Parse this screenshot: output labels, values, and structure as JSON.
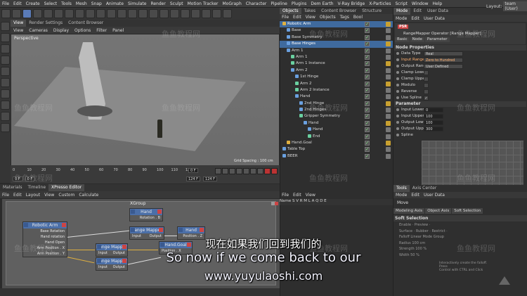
{
  "menubar": {
    "items": [
      "File",
      "Edit",
      "Create",
      "Select",
      "Tools",
      "Mesh",
      "Snap",
      "Animate",
      "Simulate",
      "Render",
      "Sculpt",
      "Motion Tracker",
      "MoGraph",
      "Character",
      "Pipeline",
      "Plugins",
      "Dem Earth",
      "V-Ray Bridge",
      "X-Particles",
      "Script",
      "Window",
      "Help"
    ],
    "layout_label": "Layout:",
    "layout_value": "team (User)"
  },
  "viewport": {
    "tabs": [
      "View",
      "Render Settings",
      "Content Browser"
    ],
    "menu": [
      "View",
      "Cameras",
      "Display",
      "Options",
      "Filter",
      "Panel"
    ],
    "label": "Perspective",
    "grid_spacing": "Grid Spacing : 100 cm"
  },
  "timeline": {
    "ticks": [
      "0",
      "10",
      "20",
      "30",
      "40",
      "50",
      "60",
      "70",
      "80",
      "90",
      "100",
      "110",
      "120"
    ],
    "current_frame": "0 F",
    "start_frame": "0 F",
    "end_frame": "124 F",
    "end_frame2": "124 F"
  },
  "objects": {
    "tabs": [
      "Objects",
      "Takes",
      "Content Browser",
      "Structure"
    ],
    "menu": [
      "File",
      "Edit",
      "View",
      "Objects",
      "Tags",
      "Bool"
    ],
    "items": [
      {
        "name": "Robotic Arm",
        "indent": 0,
        "sel": true,
        "color": "#e0b040"
      },
      {
        "name": "Base",
        "indent": 1,
        "sel": false,
        "color": "#6aa0e0"
      },
      {
        "name": "Base Symmetry",
        "indent": 1,
        "sel": false,
        "color": "#6aa0e0"
      },
      {
        "name": "Base Hinges",
        "indent": 1,
        "sel": true,
        "color": "#6aa0e0"
      },
      {
        "name": "Arm 1",
        "indent": 1,
        "sel": false,
        "color": "#6aa0e0"
      },
      {
        "name": "Arm 1",
        "indent": 2,
        "sel": false,
        "color": "#6ad0a0"
      },
      {
        "name": "Arm 1 Instance",
        "indent": 2,
        "sel": false,
        "color": "#6ad0a0"
      },
      {
        "name": "Arm 2",
        "indent": 2,
        "sel": false,
        "color": "#6aa0e0"
      },
      {
        "name": "1st Hinge",
        "indent": 3,
        "sel": false,
        "color": "#6aa0e0"
      },
      {
        "name": "Arm 2",
        "indent": 3,
        "sel": false,
        "color": "#6ad0a0"
      },
      {
        "name": "Arm 2 Instance",
        "indent": 3,
        "sel": false,
        "color": "#6ad0a0"
      },
      {
        "name": "Hand",
        "indent": 3,
        "sel": false,
        "color": "#6aa0e0"
      },
      {
        "name": "2nd Hinge",
        "indent": 4,
        "sel": false,
        "color": "#6aa0e0"
      },
      {
        "name": "2nd Hinges",
        "indent": 4,
        "sel": false,
        "color": "#6aa0e0"
      },
      {
        "name": "Gripper Symmetry",
        "indent": 4,
        "sel": false,
        "color": "#6ad0a0"
      },
      {
        "name": "Hand",
        "indent": 5,
        "sel": false,
        "color": "#6aa0e0"
      },
      {
        "name": "Hand",
        "indent": 6,
        "sel": false,
        "color": "#6aa0e0"
      },
      {
        "name": "End",
        "indent": 6,
        "sel": false,
        "color": "#6ad0a0"
      },
      {
        "name": "Hand.Goal",
        "indent": 1,
        "sel": false,
        "color": "#e0b040"
      },
      {
        "name": "Table Top",
        "indent": 0,
        "sel": false,
        "color": "#6aa0e0"
      },
      {
        "name": "BEER",
        "indent": 0,
        "sel": false,
        "color": "#6aa0e0"
      }
    ]
  },
  "attributes": {
    "tabs": [
      "Mode",
      "Edit",
      "User Data"
    ],
    "menu": [
      "Mode",
      "Edit",
      "User Data"
    ],
    "badge": "PSR",
    "title": "RangeMapper Operator [Range Mapper]",
    "subtabs": [
      "Basic",
      "Node",
      "Parameter"
    ],
    "section_node": "Node Properties",
    "node_props": [
      {
        "label": "Data Type",
        "value": "Real",
        "type": "drop",
        "hl": false
      },
      {
        "label": "Input Range",
        "value": "Zero to Hundred",
        "type": "drop",
        "hl": true
      },
      {
        "label": "Output Range",
        "value": "User Defined",
        "type": "drop",
        "hl": false
      },
      {
        "label": "Clamp Lower",
        "value": "",
        "type": "chk",
        "hl": false
      },
      {
        "label": "Clamp Upper",
        "value": "",
        "type": "chk",
        "hl": false
      },
      {
        "label": "Modulo",
        "value": "",
        "type": "chk",
        "hl": false
      },
      {
        "label": "Reverse",
        "value": "",
        "type": "chk",
        "hl": false
      },
      {
        "label": "Use Spline",
        "value": "✓",
        "type": "chk",
        "hl": false
      }
    ],
    "section_param": "Parameter",
    "param_props": [
      {
        "label": "Input Lower",
        "value": "0"
      },
      {
        "label": "Input Upper",
        "value": "100"
      },
      {
        "label": "Output Lower",
        "value": "100"
      },
      {
        "label": "Output Upper",
        "value": "300"
      }
    ],
    "spline_label": "Spline"
  },
  "xpresso": {
    "tabs": [
      "Materials",
      "Timeline",
      "XPresso Editor"
    ],
    "menu": [
      "File",
      "Edit",
      "Layout",
      "View",
      "Custom",
      "Calculate"
    ],
    "group_title": "XGroup",
    "nodes": {
      "robotic_arm": {
        "title": "Robotic Arm",
        "ports": [
          "Base Rotation",
          "Hand rotation",
          "Hand Open",
          "Arm Position . X",
          "Arm Position . Y"
        ]
      },
      "hand_top": {
        "title": "Hand",
        "ports": [
          "Rotation . B"
        ]
      },
      "range_mapper_1": {
        "title": "Range Mapper",
        "in": "Input",
        "out": "Output"
      },
      "range_mapper_2": {
        "title": "Range Mapper",
        "in": "Input",
        "out": "Output"
      },
      "range_mapper_3": {
        "title": "Range Mapper",
        "in": "Input",
        "out": "Output"
      },
      "hand_mid": {
        "title": "Hand",
        "ports": [
          "Position . Z"
        ]
      },
      "hand_goal": {
        "title": "Hand.Goal",
        "ports": [
          "Position . X"
        ]
      }
    }
  },
  "file_panel": {
    "menu": [
      "File",
      "Edit",
      "View"
    ],
    "columns": "Name    S V R M L A Q D E"
  },
  "tools": {
    "tabs": [
      "Tools",
      "Axis Center"
    ],
    "menu": [
      "Mode",
      "Edit",
      "User Data"
    ],
    "tool_name": "Move",
    "subtabs": [
      "Modeling Axis",
      "Object Axis",
      "Soft Selection"
    ],
    "section": "Soft Selection",
    "props": [
      "Enable · Preview ·",
      "Surface · Rubber · Restrict ·",
      "Falloff  Linear   Mode  Group",
      "Radius   100 cm",
      "Strength  100 %",
      "Width     50 %"
    ],
    "hint": "Interactively create the falloff. Press\n Control with CTRL and Click"
  },
  "subtitles": {
    "cn": "现在如果我们回到我们的",
    "en": "So now if we come back to our",
    "url": "www.yuyulaoshi.com"
  },
  "watermark": "鱼鱼教程网"
}
